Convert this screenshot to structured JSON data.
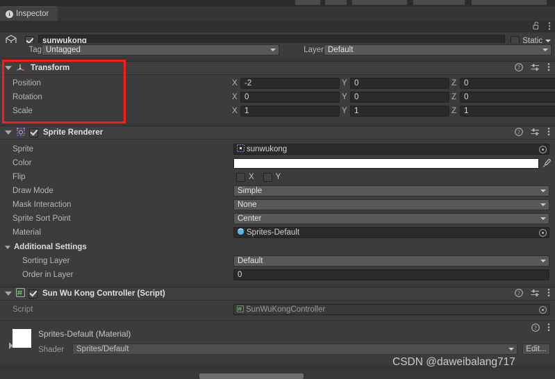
{
  "window": {
    "tab_label": "Inspector",
    "tab_icon": "info-icon",
    "lock_icon": "lock-open-icon",
    "menu_icon": "kebab-menu-icon"
  },
  "object_header": {
    "icon": "cube-icon",
    "enabled_checkbox": "checked",
    "name": "sunwukong",
    "static_label": "Static",
    "static_caret": "chevron-down-icon"
  },
  "tag_layer": {
    "tag_label": "Tag",
    "tag_value": "Untagged",
    "layer_label": "Layer",
    "layer_value": "Default"
  },
  "transform": {
    "title": "Transform",
    "icon": "transform-axis-icon",
    "help_icon": "help-icon",
    "preset_icon": "preset-settings-icon",
    "menu_icon": "kebab-menu-icon",
    "rows": [
      {
        "label": "Position",
        "x": "-2",
        "y": "0",
        "z": "0"
      },
      {
        "label": "Rotation",
        "x": "0",
        "y": "0",
        "z": "0"
      },
      {
        "label": "Scale",
        "x": "1",
        "y": "1",
        "z": "1"
      }
    ],
    "axis_x": "X",
    "axis_y": "Y",
    "axis_z": "Z"
  },
  "sprite_renderer": {
    "title": "Sprite Renderer",
    "icon": "sprite-renderer-icon",
    "enabled_checkbox": "checked",
    "help_icon": "help-icon",
    "preset_icon": "preset-settings-icon",
    "menu_icon": "kebab-menu-icon",
    "sprite_label": "Sprite",
    "sprite_value": "sunwukong",
    "color_label": "Color",
    "color_value": "#ffffff",
    "flip_label": "Flip",
    "flip_x_label": "X",
    "flip_y_label": "Y",
    "draw_mode_label": "Draw Mode",
    "draw_mode_value": "Simple",
    "mask_interaction_label": "Mask Interaction",
    "mask_interaction_value": "None",
    "sprite_sort_point_label": "Sprite Sort Point",
    "sprite_sort_point_value": "Center",
    "material_label": "Material",
    "material_value": "Sprites-Default",
    "additional_settings_label": "Additional Settings",
    "sorting_layer_label": "Sorting Layer",
    "sorting_layer_value": "Default",
    "order_in_layer_label": "Order in Layer",
    "order_in_layer_value": "0"
  },
  "script_component": {
    "title": "Sun Wu Kong Controller (Script)",
    "icon": "csharp-script-icon",
    "enabled_checkbox": "checked",
    "help_icon": "help-icon",
    "preset_icon": "preset-settings-icon",
    "menu_icon": "kebab-menu-icon",
    "script_label": "Script",
    "script_value": "SunWuKongController"
  },
  "material_footer": {
    "title": "Sprites-Default (Material)",
    "shader_label": "Shader",
    "shader_value": "Sprites/Default",
    "edit_label": "Edit...",
    "help_icon": "help-icon",
    "menu_icon": "kebab-menu-icon",
    "foldout": "collapsed"
  },
  "annotation": {
    "highlight_color": "#ff1a1a",
    "target": "transform-section"
  },
  "watermark": {
    "text": "CSDN @daweibalang717"
  }
}
